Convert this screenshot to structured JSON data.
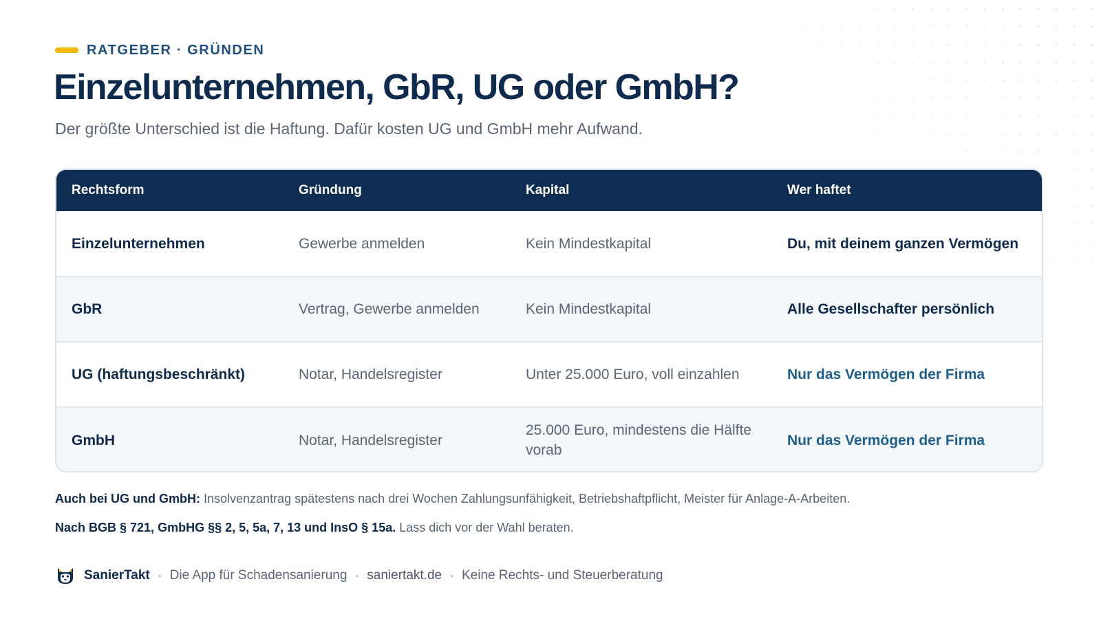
{
  "header": {
    "eyebrow": "RATGEBER · GRÜNDEN",
    "title": "Einzelunternehmen, GbR, UG oder GmbH?",
    "subtitle": "Der größte Unterschied ist die Haftung. Dafür kosten UG und GmbH mehr Aufwand."
  },
  "table": {
    "headers": [
      "Rechtsform",
      "Gründung",
      "Kapital",
      "Wer haftet"
    ],
    "rows": [
      [
        "Einzelunternehmen",
        "Gewerbe anmelden",
        "Kein Mindestkapital",
        "Du, mit deinem ganzen Vermögen"
      ],
      [
        "GbR",
        "Vertrag, Gewerbe anmelden",
        "Kein Mindestkapital",
        "Alle Gesellschafter persönlich"
      ],
      [
        "UG (haftungsbeschränkt)",
        "Notar, Handelsregister",
        "Unter 25.000 Euro, voll einzahlen",
        "Nur das Vermögen der Firma"
      ],
      [
        "GmbH",
        "Notar, Handelsregister",
        "25.000 Euro, mindestens die Hälfte vorab",
        "Nur das Vermögen der Firma"
      ]
    ]
  },
  "notes": {
    "note1_bold": "Auch bei UG und GmbH:",
    "note1_text": "Insolvenzantrag spätestens nach drei Wochen Zahlungsunfähigkeit, Betriebshaftpflicht, Meister für Anlage-A-Arbeiten.",
    "note2_bold": "Nach BGB § 721, GmbHG §§ 2, 5, 5a, 7, 13 und InsO § 15a.",
    "note2_text": "Lass dich vor der Wahl beraten."
  },
  "footer": {
    "logo_icon": "husky-logo-icon",
    "brand": "SanierTakt",
    "tagline": "Die App für Schadensanierung",
    "url": "saniertakt.de",
    "disclaimer": "Keine Rechts- und Steuerberatung",
    "separator": "•"
  },
  "colors": {
    "navy": "#0e2d52",
    "accent_yellow": "#f5b800",
    "link_blue": "#1f5f8f",
    "muted": "#5a6574"
  }
}
